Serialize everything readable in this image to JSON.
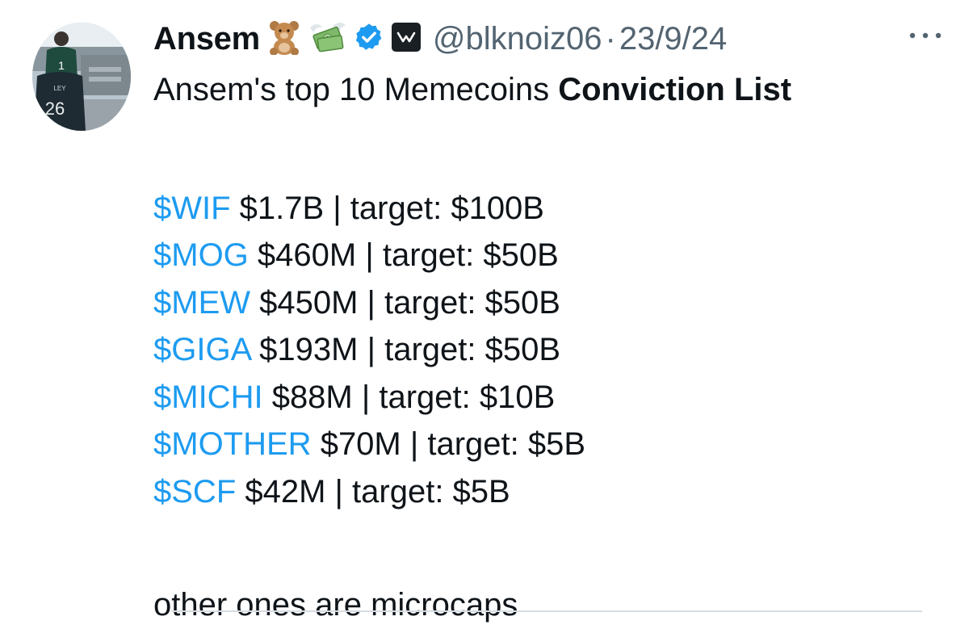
{
  "author": {
    "display_name": "Ansem",
    "emoji_1": "teddy-bear-emoji",
    "emoji_2": "money-with-wings-emoji",
    "handle": "@blknoiz06",
    "separator": "·",
    "date": "23/9/24",
    "avatar_jersey_text": "26"
  },
  "tweet": {
    "intro_plain": "Ansem's top 10 Memecoins ",
    "intro_bold": "Conviction List",
    "list": [
      {
        "ticker": "$WIF",
        "text": " $1.7B | target: $100B"
      },
      {
        "ticker": "$MOG",
        "text": " $460M | target: $50B"
      },
      {
        "ticker": "$MEW",
        "text": " $450M | target: $50B"
      },
      {
        "ticker": "$GIGA",
        "text": " $193M | target: $50B"
      },
      {
        "ticker": "$MICHI",
        "text": " $88M | target: $10B"
      },
      {
        "ticker": "$MOTHER",
        "text": " $70M | target: $5B"
      },
      {
        "ticker": "$SCF",
        "text": " $42M | target: $5B"
      }
    ],
    "outro": "other ones are microcaps"
  },
  "colors": {
    "cashtag": "#1d9bf0",
    "verified": "#1d9bf0",
    "muted": "#536471",
    "text": "#0f1419"
  }
}
